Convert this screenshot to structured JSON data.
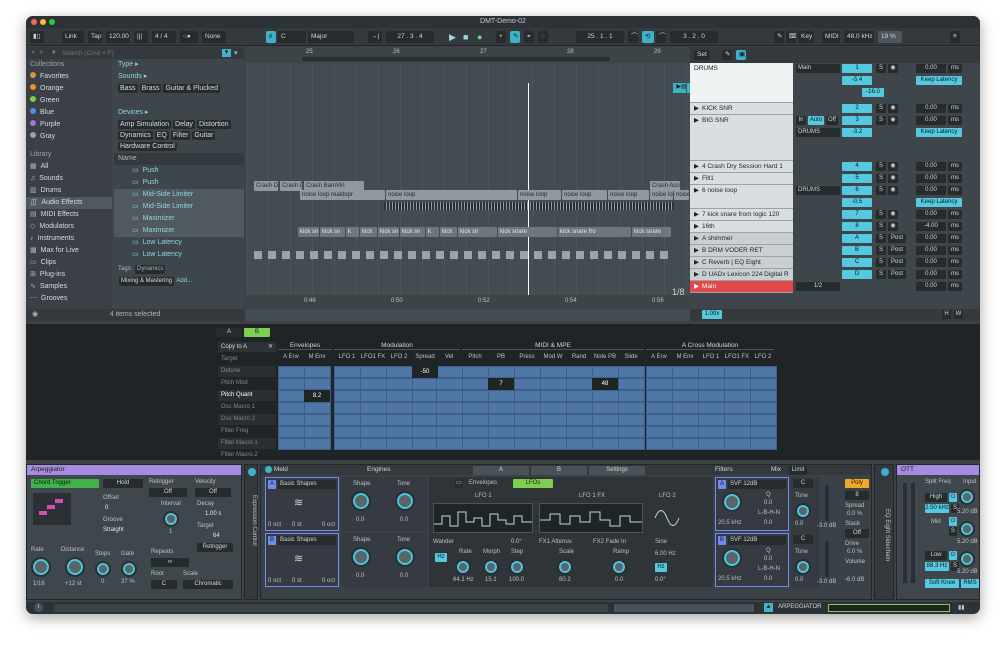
{
  "window": {
    "title": "DMT-Demo-02"
  },
  "toolbar": {
    "link": "Link",
    "tap": "Tap",
    "tempo": "120.00",
    "signature": "4 / 4",
    "groove": "None",
    "key": "C",
    "scale": "Major",
    "position": "27 . 3 . 4",
    "loop_start": "25 . 1 . 1",
    "loop_len": "3 . 2 . 0",
    "key_label": "Key",
    "midi_label": "MIDI",
    "sample_rate": "48.0 kHz",
    "cpu": "19 %"
  },
  "browser": {
    "search_placeholder": "Search (Cmd + F)",
    "collections_title": "Collections",
    "collections": [
      {
        "label": "Favorites",
        "color": "#e0913a"
      },
      {
        "label": "Orange",
        "color": "#f0902d"
      },
      {
        "label": "Green",
        "color": "#7ecf4f"
      },
      {
        "label": "Blue",
        "color": "#4a8ee6"
      },
      {
        "label": "Purple",
        "color": "#a56fe0"
      },
      {
        "label": "Gray",
        "color": "#9aa2a6"
      }
    ],
    "library_title": "Library",
    "library": [
      "All",
      "Sounds",
      "Drums",
      "Audio Effects",
      "MIDI Effects",
      "Modulators",
      "Instruments",
      "Max for Live",
      "Clips",
      "Plug-ins",
      "Samples",
      "Grooves"
    ],
    "library_selected": 3,
    "type_label": "Type",
    "sounds_label": "Sounds",
    "sound_tags": [
      "Bass",
      "Brass",
      "Guitar & Plucked"
    ],
    "devices_label": "Devices",
    "device_tags": [
      "Amp Simulation",
      "Delay",
      "Distortion",
      "Dynamics",
      "EQ",
      "Filter",
      "Guitar",
      "Hardware Control"
    ],
    "name_col": "Name",
    "items": [
      "Push",
      "Push",
      "Mid-Side Limiter",
      "Mid-Side Limiter",
      "Maximizer",
      "Maximizer",
      "Low Latency",
      "Low Latency"
    ],
    "tags_label": "Tags:",
    "tags": [
      "Dynamics",
      "Mixing & Mastering"
    ],
    "tags_add": "Add...",
    "status": "4 items selected"
  },
  "arrangement": {
    "bars": [
      "25",
      "26",
      "27",
      "28",
      "29"
    ],
    "times": [
      "0:48",
      "0:50",
      "0:52",
      "0:54",
      "0:56"
    ],
    "zoom_ratio": "1/8",
    "crash_clips": [
      "Crash D",
      "Crash D",
      "Crash BamVin",
      "Crash Acou"
    ],
    "noise_clips": [
      "noise loop reaktopr",
      "noise loop",
      "noise loop",
      "noise loop",
      "noise loop",
      "noise loop",
      "noise loop"
    ],
    "kick_clips": [
      "kick sn",
      "kick sn",
      "k",
      "kick",
      "kick sn",
      "kick sn",
      "k",
      "kick",
      "kick sn",
      "kick snare",
      "kick snare fro",
      "kick snare"
    ]
  },
  "tracks": {
    "set_label": "Set",
    "list": [
      {
        "name": "DRUMS",
        "num": "1",
        "route": "Main",
        "pan": "-5.4",
        "vol": "-16.0",
        "delay": "0.00",
        "unit": "ms",
        "latency": "Keep Latency"
      },
      {
        "name": "KICK SNR",
        "num": "2",
        "delay": "0.00",
        "unit": "ms"
      },
      {
        "name": "BIG SNR",
        "num": "3",
        "route": "DRUMS",
        "pan": "-3.2",
        "delay": "0.00",
        "unit": "ms",
        "latency": "Keep Latency"
      },
      {
        "name": "4 Crash Dry Session Hard 1",
        "num": "4",
        "delay": "0.00",
        "unit": "ms"
      },
      {
        "name": "Fill1",
        "num": "5",
        "delay": "0.00",
        "unit": "ms"
      },
      {
        "name": "6 noise loop",
        "num": "6",
        "route": "DRUMS",
        "pan": "-0.5",
        "delay": "0.00",
        "unit": "ms",
        "latency": "Keep Latency"
      },
      {
        "name": "7 kick snare from logic 120",
        "num": "7",
        "delay": "0.00",
        "unit": "ms"
      },
      {
        "name": "16th",
        "num": "8",
        "delay": "-4.00",
        "unit": "ms"
      }
    ],
    "returns": [
      {
        "name": "A shimmer",
        "num": "A",
        "delay": "0.00",
        "unit": "ms"
      },
      {
        "name": "B DRM VODER RET",
        "num": "B",
        "delay": "0.00",
        "unit": "ms"
      },
      {
        "name": "C Reverb | EQ Eight",
        "num": "C",
        "delay": "0.00",
        "unit": "ms"
      },
      {
        "name": "D UADx Lexicon 224 Digital R",
        "num": "D",
        "delay": "0.00",
        "unit": "ms"
      }
    ],
    "main": {
      "name": "Main",
      "route": "1/2",
      "delay": "0.00",
      "unit": "ms"
    },
    "in_label": "In",
    "auto_label": "Auto",
    "off_label": "Off",
    "post_label": "Post",
    "zoom": "1.00x",
    "h": "H",
    "w": "W"
  },
  "mod_matrix": {
    "tab_a": "A",
    "tab_b": "B",
    "copy": "Copy to A",
    "targets": [
      "Target",
      "Detune",
      "Pitch Mod",
      "Pitch Quant",
      "Osc Macro 1",
      "Osc Macro 2",
      "Filter Freq",
      "Filter Macro 1",
      "Filter Macro 2"
    ],
    "groups": [
      "Envelopes",
      "Modulation",
      "MIDI & MPE",
      "A Cross Modulation"
    ],
    "columns": [
      "A Env",
      "M Env",
      "LFO 1",
      "LFO1 FX",
      "LFO 2",
      "Spread",
      "Vel",
      "Pitch",
      "PB",
      "Press",
      "Mod W",
      "Rand",
      "Note PB",
      "Slide",
      "A Env",
      "M Env",
      "LFO 1",
      "LFO1 FX",
      "LFO 2"
    ],
    "vals": {
      "spread": "-50",
      "menv": "8.2",
      "pb": "7",
      "notepb": "48"
    }
  },
  "arpeggiator": {
    "title": "Arpeggiator",
    "mode": "Chord Trigger",
    "hold": "Hold",
    "offset_label": "Offset",
    "offset": "0",
    "groove_label": "Groove",
    "groove": "Straight",
    "retrigger_label": "Retrigger",
    "retrigger": "Off",
    "velocity_label": "Velocity",
    "velocity": "Off",
    "interval_label": "Interval",
    "interval": "1",
    "decay_label": "Decay",
    "decay": "1.00 s",
    "target_label": "Target",
    "target": "64",
    "repeats_label": "Repeats",
    "retrigger_btn": "Retrigger",
    "rate_label": "Rate",
    "rate": "1/16",
    "distance_label": "Distance",
    "distance": "+12 st",
    "steps_label": "Steps",
    "steps": "0",
    "gate_label": "Gate",
    "gate": "37 %",
    "root_label": "Root",
    "root": "C",
    "scale_label": "Scale",
    "scale": "Chromatic",
    "expr_label": "Expression Control"
  },
  "meld": {
    "title": "Meld",
    "engines": "Engines",
    "tab_a": "A",
    "tab_b": "B",
    "settings": "Settings",
    "osc_a": "Basic Shapes",
    "osc_b": "Basic Shapes",
    "oct": "0 oct",
    "st": "0 st",
    "shape_label": "Shape",
    "tone_label": "Tone",
    "shape_a": "0.0",
    "tone_a": "0.0",
    "shape_b": "0.0",
    "tone_b": "0.0",
    "env_tab": "Envelopes",
    "lfo_tab": "LFOs",
    "lfo1": "LFO 1",
    "lfo1fx": "LFO 1 FX",
    "lfo2": "LFO 2",
    "wander": "Wander",
    "wander_val": "0.0°",
    "rate_label": "Rate",
    "rate": "64.1 Hz",
    "morph_label": "Morph",
    "morph": "15.1",
    "step_label": "Step",
    "step": "100.0",
    "fx1": "FX1 Attenuv.",
    "fx2": "FX2 Fade In",
    "scale_label": "Scale",
    "scale": "80.2",
    "ramp_label": "Ramp",
    "ramp": "0.0",
    "sine": "Sine",
    "sine_rate": "6.00 Hz",
    "sine_phase": "0.0°",
    "hz": "Hz",
    "filters": "Filters",
    "filter_a": "SVF 12dB",
    "filter_b": "SVF 12dB",
    "freq_a": "20.5 kHz",
    "freq_b": "20.5 kHz",
    "q": "Q",
    "qval": "0.0",
    "lhn": "L-B-H-N",
    "lhn_val": "0.0",
    "mix": "Mix",
    "limit": "Limit",
    "c_label": "C",
    "tone_mix": "Tone",
    "tone_mix_val": "0.0",
    "db": "-3.0 dB",
    "poly": "Poly",
    "voices": "8",
    "spread_label": "Spread",
    "spread": "0.0 %",
    "stack_label": "Stack",
    "stack": "Off",
    "drive_label": "Drive",
    "drive": "0.0 %",
    "volume_label": "Volume",
    "volume": "-6.0 dB",
    "eq_label": "EQ Eight",
    "sidechain": "Sidechain"
  },
  "ott": {
    "title": "OTT",
    "split": "Split Freq",
    "input": "Input",
    "high": "High",
    "high_freq": "2.50 kHz",
    "s": "S",
    "mid": "Mid",
    "low": "Low",
    "low_freq": "88.3 Hz",
    "db": "5.20 dB",
    "soft_knee": "Soft Knee",
    "rms": "RMS"
  },
  "statusbar": {
    "device": "ARPEGGIATOR"
  }
}
